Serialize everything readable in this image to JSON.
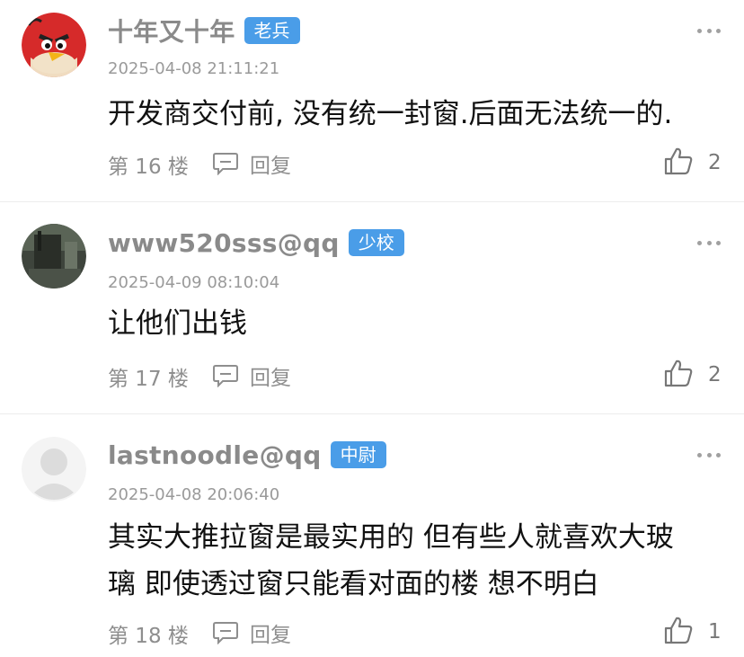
{
  "comments": [
    {
      "username": "十年又十年",
      "badge": "老兵",
      "timestamp": "2025-04-08 21:11:21",
      "text_lines": [
        "开发商交付前, 没有统一封窗.后面无法统一的."
      ],
      "floor": "第 16 楼",
      "reply_label": "回复",
      "likes": "2",
      "avatar": "angry-bird-avatar"
    },
    {
      "username": "www520sss@qq",
      "badge": "少校",
      "timestamp": "2025-04-09 08:10:04",
      "text_lines": [
        "让他们出钱"
      ],
      "floor": "第 17 楼",
      "reply_label": "回复",
      "likes": "2",
      "avatar": "photo-avatar"
    },
    {
      "username": "lastnoodle@qq",
      "badge": "中尉",
      "timestamp": "2025-04-08 20:06:40",
      "text_lines": [
        "其实大推拉窗是最实用的 但有些人就喜欢大玻",
        "璃 即使透过窗只能看对面的楼 想不明白"
      ],
      "floor": "第 18 楼",
      "reply_label": "回复",
      "likes": "1",
      "avatar": "default-user-avatar"
    }
  ],
  "colors": {
    "badge": "#4a9de8",
    "username": "#8a8a8a",
    "divider": "#ececec"
  }
}
